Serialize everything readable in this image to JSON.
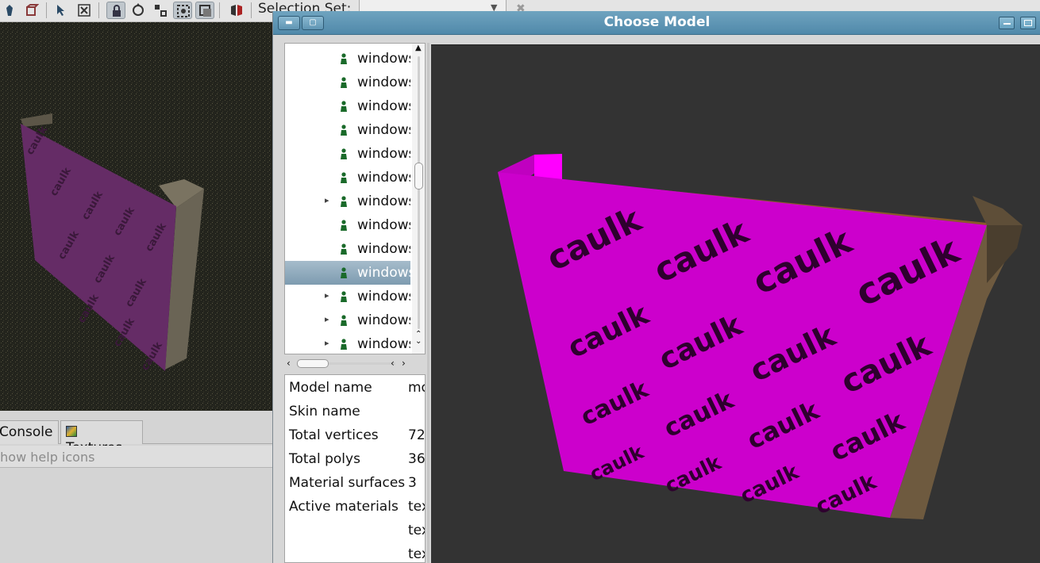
{
  "toolbar": {
    "selection_set_label": "Selection Set:",
    "selection_set_value": ""
  },
  "left_panel": {
    "tabs": [
      {
        "label": "Console"
      },
      {
        "label": "Textures"
      }
    ],
    "help_text": "Show help icons",
    "viewport_texture_text": "caulk"
  },
  "dialog": {
    "title": "Choose Model",
    "tree_items": [
      {
        "label": "windows",
        "expandable": false,
        "selected": false
      },
      {
        "label": "windows",
        "expandable": false,
        "selected": false
      },
      {
        "label": "windows",
        "expandable": false,
        "selected": false
      },
      {
        "label": "windows",
        "expandable": false,
        "selected": false
      },
      {
        "label": "windows",
        "expandable": false,
        "selected": false
      },
      {
        "label": "windows",
        "expandable": false,
        "selected": false
      },
      {
        "label": "windows",
        "expandable": true,
        "selected": false
      },
      {
        "label": "windows",
        "expandable": false,
        "selected": false
      },
      {
        "label": "windows",
        "expandable": false,
        "selected": false
      },
      {
        "label": "windows",
        "expandable": false,
        "selected": true
      },
      {
        "label": "windows",
        "expandable": true,
        "selected": false
      },
      {
        "label": "windows",
        "expandable": true,
        "selected": false
      },
      {
        "label": "windows",
        "expandable": true,
        "selected": false
      }
    ],
    "properties": [
      {
        "name": "Model name",
        "value": "models"
      },
      {
        "name": "Skin name",
        "value": ""
      },
      {
        "name": "Total vertices",
        "value": "72"
      },
      {
        "name": "Total polys",
        "value": "36"
      },
      {
        "name": "Material surfaces",
        "value": "3"
      },
      {
        "name": "Active materials",
        "value": "textures"
      },
      {
        "name": "",
        "value": "textures"
      },
      {
        "name": "",
        "value": "textures"
      }
    ],
    "preview_texture_text": "caulk"
  },
  "colors": {
    "title_bar": "#5a93b3",
    "selection": "#8aa6b9",
    "caulk": "#cc00cc",
    "preview_bg": "#333333"
  }
}
